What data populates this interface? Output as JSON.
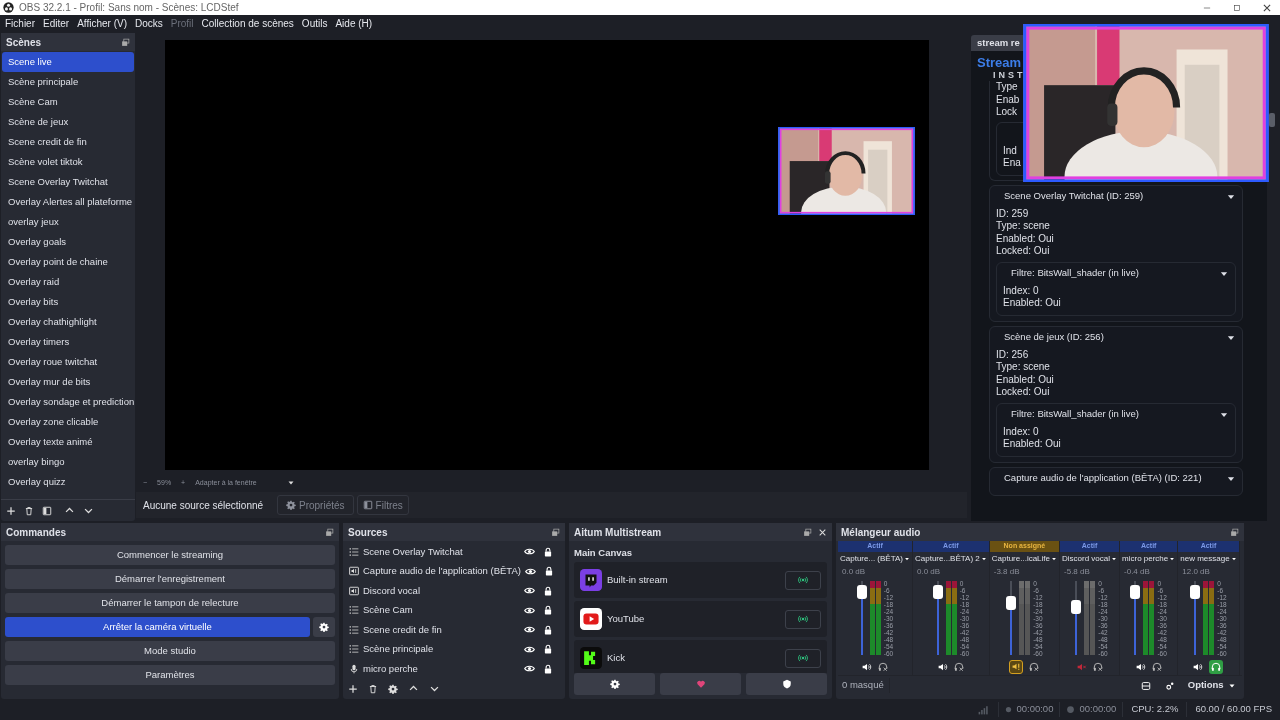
{
  "window": {
    "title": "OBS 32.2.1 - Profil: Sans nom - Scènes: LCDStef"
  },
  "menu": [
    {
      "label": "Fichier",
      "disabled": false
    },
    {
      "label": "Editer",
      "disabled": false
    },
    {
      "label": "Afficher (V)",
      "disabled": false
    },
    {
      "label": "Docks",
      "disabled": false
    },
    {
      "label": "Profil",
      "disabled": true
    },
    {
      "label": "Collection de scènes",
      "disabled": false
    },
    {
      "label": "Outils",
      "disabled": false
    },
    {
      "label": "Aide (H)",
      "disabled": false
    }
  ],
  "scenes": {
    "title": "Scènes",
    "items": [
      {
        "label": "Scene live",
        "selected": true
      },
      {
        "label": "Scène principale",
        "selected": false
      },
      {
        "label": "Scène Cam",
        "selected": false
      },
      {
        "label": "Scène de jeux",
        "selected": false
      },
      {
        "label": "Scene credit de fin",
        "selected": false
      },
      {
        "label": "Scène volet tiktok",
        "selected": false
      },
      {
        "label": "Scene Overlay Twitchat",
        "selected": false
      },
      {
        "label": "Overlay Alertes all plateforme",
        "selected": false
      },
      {
        "label": "overlay jeux",
        "selected": false
      },
      {
        "label": "Overlay goals",
        "selected": false
      },
      {
        "label": "Overlay point de chaine",
        "selected": false
      },
      {
        "label": "Overlay raid",
        "selected": false
      },
      {
        "label": "Overlay bits",
        "selected": false
      },
      {
        "label": "Overlay chathighlight",
        "selected": false
      },
      {
        "label": "Overlay timers",
        "selected": false
      },
      {
        "label": "Overlay roue twitchat",
        "selected": false
      },
      {
        "label": "Overlay mur de bits",
        "selected": false
      },
      {
        "label": "Overlay sondage et prediction",
        "selected": false
      },
      {
        "label": "Overlay zone clicable",
        "selected": false
      },
      {
        "label": "Overlay texte animé",
        "selected": false
      },
      {
        "label": "overlay bingo",
        "selected": false
      },
      {
        "label": "Overlay quizz",
        "selected": false
      }
    ]
  },
  "preview": {
    "zoom_out": "−",
    "zoom": "59%",
    "zoom_in": "+",
    "fit": "Adapter à la fenêtre"
  },
  "source_bar": {
    "status": "Aucune source sélectionné",
    "properties": "Propriétés",
    "filters": "Filtres"
  },
  "browser_dock": {
    "tab": "stream re",
    "brand": "Stream",
    "brand_sub": "INST",
    "partial_lines": [
      "Type",
      "Enab",
      "Lock"
    ],
    "partial_filter_lines": [
      "Ind",
      "Ena"
    ],
    "cards": [
      {
        "title": "Scene Overlay Twitchat (ID: 259)",
        "expanded": true,
        "lines": [
          "ID: 259",
          "Type: scene",
          "Enabled: Oui",
          "Locked: Oui"
        ],
        "filters": [
          {
            "title": "Filtre: BitsWall_shader (in live)",
            "expanded": true,
            "lines": [
              "Index: 0",
              "Enabled: Oui"
            ]
          }
        ]
      },
      {
        "title": "Scène de jeux (ID: 256)",
        "expanded": true,
        "lines": [
          "ID: 256",
          "Type: scene",
          "Enabled: Oui",
          "Locked: Oui"
        ],
        "filters": [
          {
            "title": "Filtre: BitsWall_shader (in live)",
            "expanded": true,
            "lines": [
              "Index: 0",
              "Enabled: Oui"
            ]
          }
        ]
      },
      {
        "title": "Capture audio de l'application (BÊTA) (ID: 221)",
        "expanded": true
      }
    ]
  },
  "controls": {
    "title": "Commandes",
    "buttons": [
      {
        "label": "Commencer le streaming",
        "active": false,
        "settings": false
      },
      {
        "label": "Démarrer l'enregistrement",
        "active": false,
        "settings": false
      },
      {
        "label": "Démarrer le tampon de relecture",
        "active": false,
        "settings": false
      },
      {
        "label": "Arrêter la caméra virtuelle",
        "active": true,
        "settings": true
      },
      {
        "label": "Mode studio",
        "active": false,
        "settings": false
      },
      {
        "label": "Paramètres",
        "active": false,
        "settings": false
      }
    ]
  },
  "sources": {
    "title": "Sources",
    "items": [
      {
        "label": "Scene Overlay Twitchat",
        "kind": "scene",
        "visible": true,
        "locked": true
      },
      {
        "label": "Capture audio de l'application (BÊTA)",
        "kind": "app",
        "visible": true,
        "locked": true
      },
      {
        "label": "Discord vocal",
        "kind": "app",
        "visible": true,
        "locked": true
      },
      {
        "label": "Scène Cam",
        "kind": "scene",
        "visible": true,
        "locked": true
      },
      {
        "label": "Scene credit de fin",
        "kind": "scene",
        "visible": true,
        "locked": true
      },
      {
        "label": "Scène principale",
        "kind": "scene",
        "visible": true,
        "locked": true
      },
      {
        "label": "micro perche",
        "kind": "mic",
        "visible": true,
        "locked": true
      }
    ]
  },
  "multistream": {
    "title": "Aitum Multistream",
    "canvas": "Main Canvas",
    "outputs": [
      {
        "label": "Built-in stream",
        "kind": "chat"
      },
      {
        "label": "YouTube",
        "kind": "play"
      },
      {
        "label": "Kick",
        "kind": "block"
      }
    ]
  },
  "mixer": {
    "title": "Mélangeur audio",
    "hidden": "0 masqué",
    "options": "Options",
    "channels": [
      {
        "status": "Actif",
        "assigned": true,
        "name": "Capture... (BÊTA)",
        "db": "0.0 dB",
        "level": 0.95,
        "meter_active": true,
        "muted": false,
        "warning": false,
        "monitoring": false,
        "scale": [
          "0",
          "-6",
          "-12",
          "-18",
          "-24",
          "-30",
          "-36",
          "-42",
          "-48",
          "-54",
          "-60"
        ]
      },
      {
        "status": "Actif",
        "assigned": true,
        "name": "Capture...BÊTA) 2",
        "db": "0.0 dB",
        "level": 0.95,
        "meter_active": true,
        "muted": false,
        "warning": false,
        "monitoring": false,
        "scale": [
          "0",
          "-6",
          "-12",
          "-18",
          "-24",
          "-30",
          "-36",
          "-42",
          "-48",
          "-54",
          "-60"
        ]
      },
      {
        "status": "Non assigné",
        "assigned": false,
        "name": "Capture...icaLife",
        "db": "-3.8 dB",
        "level": 0.8,
        "meter_active": false,
        "muted": false,
        "warning": true,
        "monitoring": false,
        "scale": [
          "0",
          "-6",
          "-12",
          "-18",
          "-24",
          "-30",
          "-36",
          "-42",
          "-48",
          "-54",
          "-60"
        ]
      },
      {
        "status": "Actif",
        "assigned": true,
        "name": "Discord vocal",
        "db": "-5.8 dB",
        "level": 0.75,
        "meter_active": false,
        "muted": true,
        "warning": false,
        "monitoring": false,
        "scale": [
          "0",
          "-6",
          "-12",
          "-18",
          "-24",
          "-30",
          "-36",
          "-42",
          "-48",
          "-54",
          "-60"
        ]
      },
      {
        "status": "Actif",
        "assigned": true,
        "name": "micro perche",
        "db": "-0.4 dB",
        "level": 0.94,
        "meter_active": true,
        "muted": false,
        "warning": false,
        "monitoring": false,
        "scale": [
          "0",
          "-6",
          "-12",
          "-18",
          "-24",
          "-30",
          "-36",
          "-42",
          "-48",
          "-54",
          "-60"
        ]
      },
      {
        "status": "Actif",
        "assigned": true,
        "name": "new message",
        "db": "12.0 dB",
        "level": 0.95,
        "meter_active": true,
        "muted": false,
        "warning": false,
        "monitoring": true,
        "scale": [
          "0",
          "-6",
          "-12",
          "-18",
          "-24",
          "-30",
          "-36",
          "-42",
          "-48",
          "-54",
          "-60"
        ]
      }
    ]
  },
  "status_bar": {
    "stream_time": "00:00:00",
    "record_time": "00:00:00",
    "cpu": "CPU: 2.2%",
    "fps": "60.00 / 60.00 FPS"
  }
}
